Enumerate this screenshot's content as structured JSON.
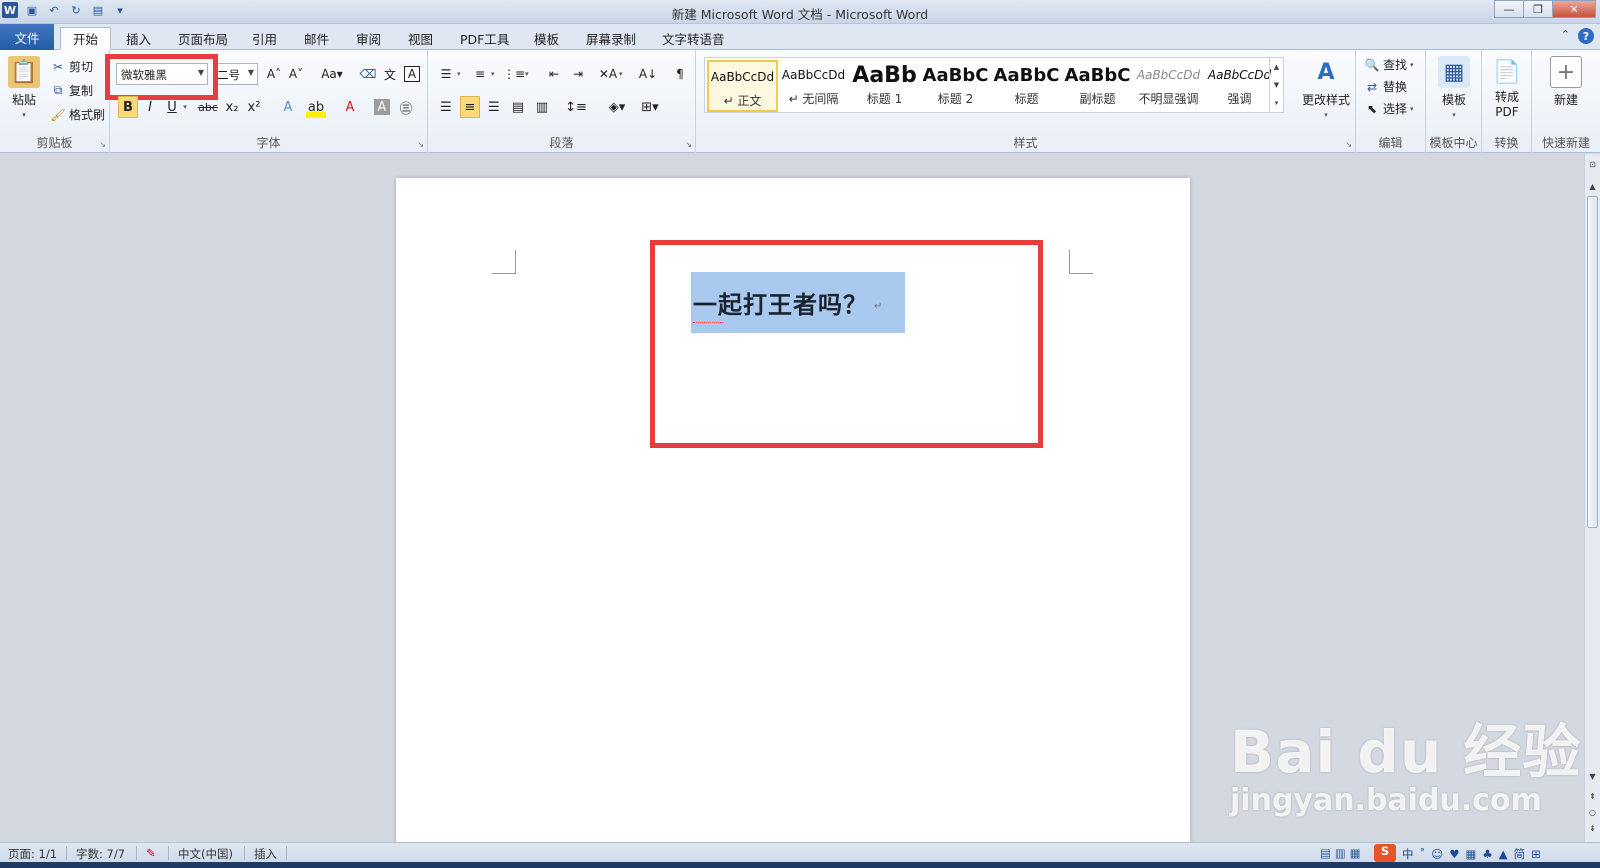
{
  "window": {
    "title": "新建 Microsoft Word 文档 - Microsoft Word"
  },
  "tabs": [
    "文件",
    "开始",
    "插入",
    "页面布局",
    "引用",
    "邮件",
    "审阅",
    "视图",
    "PDF工具",
    "模板",
    "屏幕录制",
    "文字转语音"
  ],
  "active_tab": "开始",
  "clipboard": {
    "paste": "粘贴",
    "cut": "剪切",
    "copy": "复制",
    "format_painter": "格式刷",
    "label": "剪贴板"
  },
  "font": {
    "name": "微软雅黑",
    "size": "二号",
    "label": "字体"
  },
  "paragraph": {
    "label": "段落"
  },
  "styles": {
    "items": [
      {
        "sample": "AaBbCcDd",
        "name": "↵ 正文"
      },
      {
        "sample": "AaBbCcDd",
        "name": "↵ 无间隔"
      },
      {
        "sample": "AaBb",
        "name": "标题 1"
      },
      {
        "sample": "AaBbC",
        "name": "标题 2"
      },
      {
        "sample": "AaBbC",
        "name": "标题"
      },
      {
        "sample": "AaBbC",
        "name": "副标题"
      },
      {
        "sample": "AaBbCcDd",
        "name": "不明显强调"
      },
      {
        "sample": "AaBbCcDd",
        "name": "强调"
      }
    ],
    "change_styles": "更改样式",
    "label": "样式"
  },
  "editing": {
    "find": "查找",
    "replace": "替换",
    "select": "选择",
    "label": "编辑"
  },
  "template_center": {
    "templates": "模板",
    "label": "模板中心"
  },
  "convert": {
    "to_pdf_line1": "转成",
    "to_pdf_line2": "PDF",
    "label": "转换"
  },
  "quick_new": {
    "new": "新建",
    "label": "快速新建"
  },
  "document": {
    "text": "一起打王者吗？",
    "para_mark": "↵"
  },
  "status_bar": {
    "page": "页面: 1/1",
    "words": "字数: 7/7",
    "language": "中文(中国)",
    "mode": "插入"
  },
  "watermark": {
    "brand": "Bai du 经验",
    "url": "jingyan.baidu.com"
  },
  "colors": {
    "accent": "#2b579a",
    "highlight_box": "#e83d3d",
    "selection": "#a9c9ee"
  }
}
